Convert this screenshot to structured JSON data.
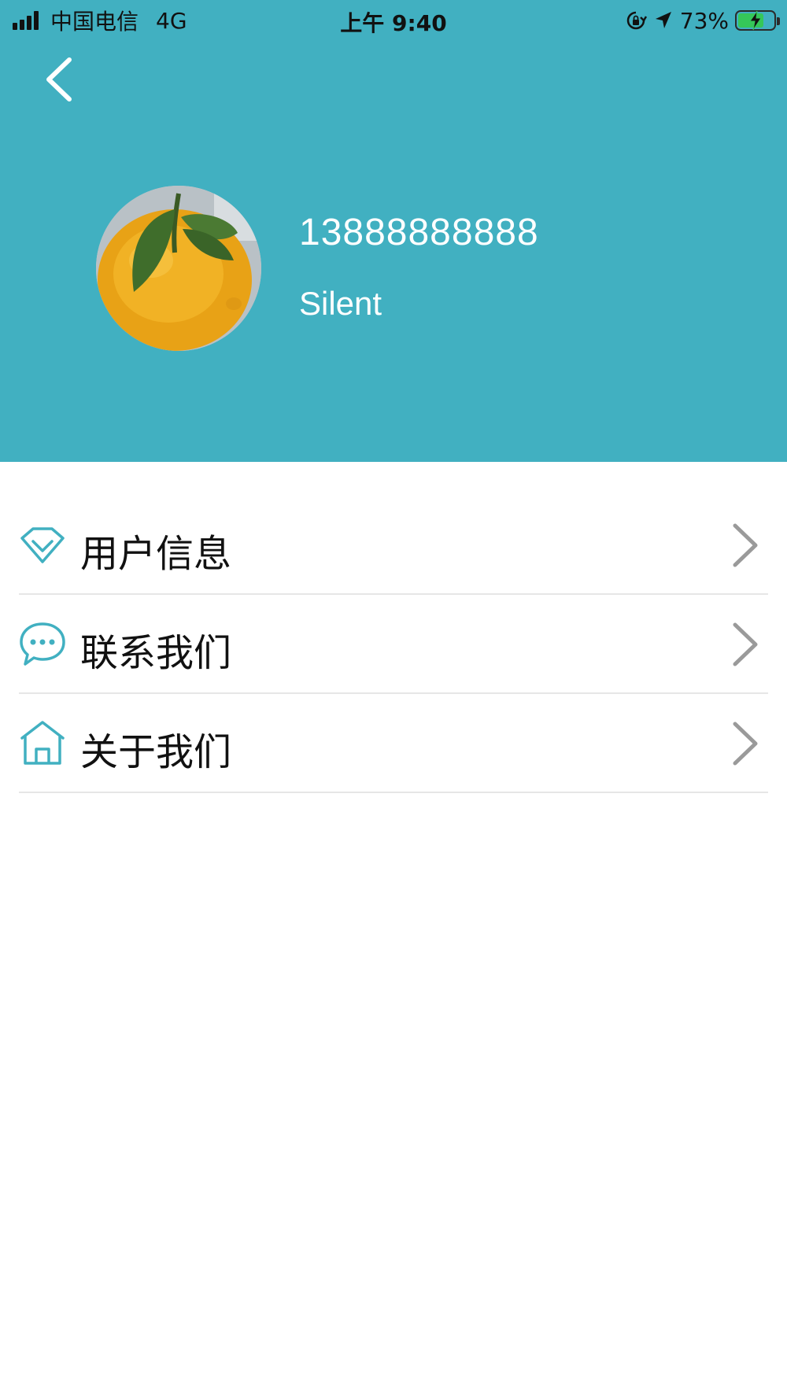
{
  "status_bar": {
    "carrier": "中国电信",
    "network": "4G",
    "time": "上午 9:40",
    "battery_percent": "73%",
    "battery_level": 0.73
  },
  "header": {
    "back_icon": "chevron-left-icon",
    "avatar_icon": "orange-avatar",
    "phone": "13888888888",
    "nickname": "Silent",
    "background_color": "#41b0c1"
  },
  "menu": {
    "items": [
      {
        "label": "用户信息",
        "icon": "diamond-icon"
      },
      {
        "label": "联系我们",
        "icon": "chat-bubble-icon"
      },
      {
        "label": "关于我们",
        "icon": "home-icon"
      }
    ],
    "accent_color": "#41b0c1",
    "chevron_icon": "chevron-right-icon"
  }
}
